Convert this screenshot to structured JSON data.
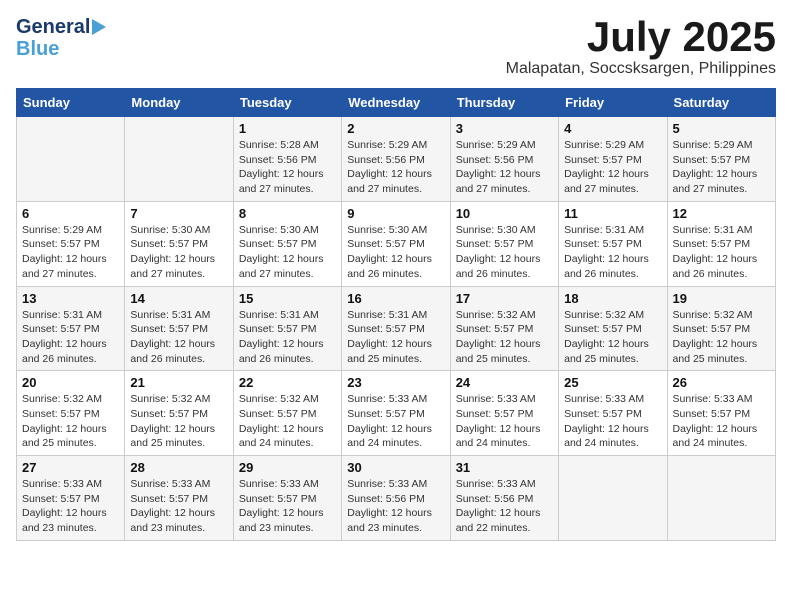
{
  "header": {
    "logo_line1": "General",
    "logo_line2": "Blue",
    "month": "July 2025",
    "location": "Malapatan, Soccsksargen, Philippines"
  },
  "weekdays": [
    "Sunday",
    "Monday",
    "Tuesday",
    "Wednesday",
    "Thursday",
    "Friday",
    "Saturday"
  ],
  "weeks": [
    [
      {
        "day": "",
        "sunrise": "",
        "sunset": "",
        "daylight": ""
      },
      {
        "day": "",
        "sunrise": "",
        "sunset": "",
        "daylight": ""
      },
      {
        "day": "1",
        "sunrise": "Sunrise: 5:28 AM",
        "sunset": "Sunset: 5:56 PM",
        "daylight": "Daylight: 12 hours and 27 minutes."
      },
      {
        "day": "2",
        "sunrise": "Sunrise: 5:29 AM",
        "sunset": "Sunset: 5:56 PM",
        "daylight": "Daylight: 12 hours and 27 minutes."
      },
      {
        "day": "3",
        "sunrise": "Sunrise: 5:29 AM",
        "sunset": "Sunset: 5:56 PM",
        "daylight": "Daylight: 12 hours and 27 minutes."
      },
      {
        "day": "4",
        "sunrise": "Sunrise: 5:29 AM",
        "sunset": "Sunset: 5:57 PM",
        "daylight": "Daylight: 12 hours and 27 minutes."
      },
      {
        "day": "5",
        "sunrise": "Sunrise: 5:29 AM",
        "sunset": "Sunset: 5:57 PM",
        "daylight": "Daylight: 12 hours and 27 minutes."
      }
    ],
    [
      {
        "day": "6",
        "sunrise": "Sunrise: 5:29 AM",
        "sunset": "Sunset: 5:57 PM",
        "daylight": "Daylight: 12 hours and 27 minutes."
      },
      {
        "day": "7",
        "sunrise": "Sunrise: 5:30 AM",
        "sunset": "Sunset: 5:57 PM",
        "daylight": "Daylight: 12 hours and 27 minutes."
      },
      {
        "day": "8",
        "sunrise": "Sunrise: 5:30 AM",
        "sunset": "Sunset: 5:57 PM",
        "daylight": "Daylight: 12 hours and 27 minutes."
      },
      {
        "day": "9",
        "sunrise": "Sunrise: 5:30 AM",
        "sunset": "Sunset: 5:57 PM",
        "daylight": "Daylight: 12 hours and 26 minutes."
      },
      {
        "day": "10",
        "sunrise": "Sunrise: 5:30 AM",
        "sunset": "Sunset: 5:57 PM",
        "daylight": "Daylight: 12 hours and 26 minutes."
      },
      {
        "day": "11",
        "sunrise": "Sunrise: 5:31 AM",
        "sunset": "Sunset: 5:57 PM",
        "daylight": "Daylight: 12 hours and 26 minutes."
      },
      {
        "day": "12",
        "sunrise": "Sunrise: 5:31 AM",
        "sunset": "Sunset: 5:57 PM",
        "daylight": "Daylight: 12 hours and 26 minutes."
      }
    ],
    [
      {
        "day": "13",
        "sunrise": "Sunrise: 5:31 AM",
        "sunset": "Sunset: 5:57 PM",
        "daylight": "Daylight: 12 hours and 26 minutes."
      },
      {
        "day": "14",
        "sunrise": "Sunrise: 5:31 AM",
        "sunset": "Sunset: 5:57 PM",
        "daylight": "Daylight: 12 hours and 26 minutes."
      },
      {
        "day": "15",
        "sunrise": "Sunrise: 5:31 AM",
        "sunset": "Sunset: 5:57 PM",
        "daylight": "Daylight: 12 hours and 26 minutes."
      },
      {
        "day": "16",
        "sunrise": "Sunrise: 5:31 AM",
        "sunset": "Sunset: 5:57 PM",
        "daylight": "Daylight: 12 hours and 25 minutes."
      },
      {
        "day": "17",
        "sunrise": "Sunrise: 5:32 AM",
        "sunset": "Sunset: 5:57 PM",
        "daylight": "Daylight: 12 hours and 25 minutes."
      },
      {
        "day": "18",
        "sunrise": "Sunrise: 5:32 AM",
        "sunset": "Sunset: 5:57 PM",
        "daylight": "Daylight: 12 hours and 25 minutes."
      },
      {
        "day": "19",
        "sunrise": "Sunrise: 5:32 AM",
        "sunset": "Sunset: 5:57 PM",
        "daylight": "Daylight: 12 hours and 25 minutes."
      }
    ],
    [
      {
        "day": "20",
        "sunrise": "Sunrise: 5:32 AM",
        "sunset": "Sunset: 5:57 PM",
        "daylight": "Daylight: 12 hours and 25 minutes."
      },
      {
        "day": "21",
        "sunrise": "Sunrise: 5:32 AM",
        "sunset": "Sunset: 5:57 PM",
        "daylight": "Daylight: 12 hours and 25 minutes."
      },
      {
        "day": "22",
        "sunrise": "Sunrise: 5:32 AM",
        "sunset": "Sunset: 5:57 PM",
        "daylight": "Daylight: 12 hours and 24 minutes."
      },
      {
        "day": "23",
        "sunrise": "Sunrise: 5:33 AM",
        "sunset": "Sunset: 5:57 PM",
        "daylight": "Daylight: 12 hours and 24 minutes."
      },
      {
        "day": "24",
        "sunrise": "Sunrise: 5:33 AM",
        "sunset": "Sunset: 5:57 PM",
        "daylight": "Daylight: 12 hours and 24 minutes."
      },
      {
        "day": "25",
        "sunrise": "Sunrise: 5:33 AM",
        "sunset": "Sunset: 5:57 PM",
        "daylight": "Daylight: 12 hours and 24 minutes."
      },
      {
        "day": "26",
        "sunrise": "Sunrise: 5:33 AM",
        "sunset": "Sunset: 5:57 PM",
        "daylight": "Daylight: 12 hours and 24 minutes."
      }
    ],
    [
      {
        "day": "27",
        "sunrise": "Sunrise: 5:33 AM",
        "sunset": "Sunset: 5:57 PM",
        "daylight": "Daylight: 12 hours and 23 minutes."
      },
      {
        "day": "28",
        "sunrise": "Sunrise: 5:33 AM",
        "sunset": "Sunset: 5:57 PM",
        "daylight": "Daylight: 12 hours and 23 minutes."
      },
      {
        "day": "29",
        "sunrise": "Sunrise: 5:33 AM",
        "sunset": "Sunset: 5:57 PM",
        "daylight": "Daylight: 12 hours and 23 minutes."
      },
      {
        "day": "30",
        "sunrise": "Sunrise: 5:33 AM",
        "sunset": "Sunset: 5:56 PM",
        "daylight": "Daylight: 12 hours and 23 minutes."
      },
      {
        "day": "31",
        "sunrise": "Sunrise: 5:33 AM",
        "sunset": "Sunset: 5:56 PM",
        "daylight": "Daylight: 12 hours and 22 minutes."
      },
      {
        "day": "",
        "sunrise": "",
        "sunset": "",
        "daylight": ""
      },
      {
        "day": "",
        "sunrise": "",
        "sunset": "",
        "daylight": ""
      }
    ]
  ]
}
